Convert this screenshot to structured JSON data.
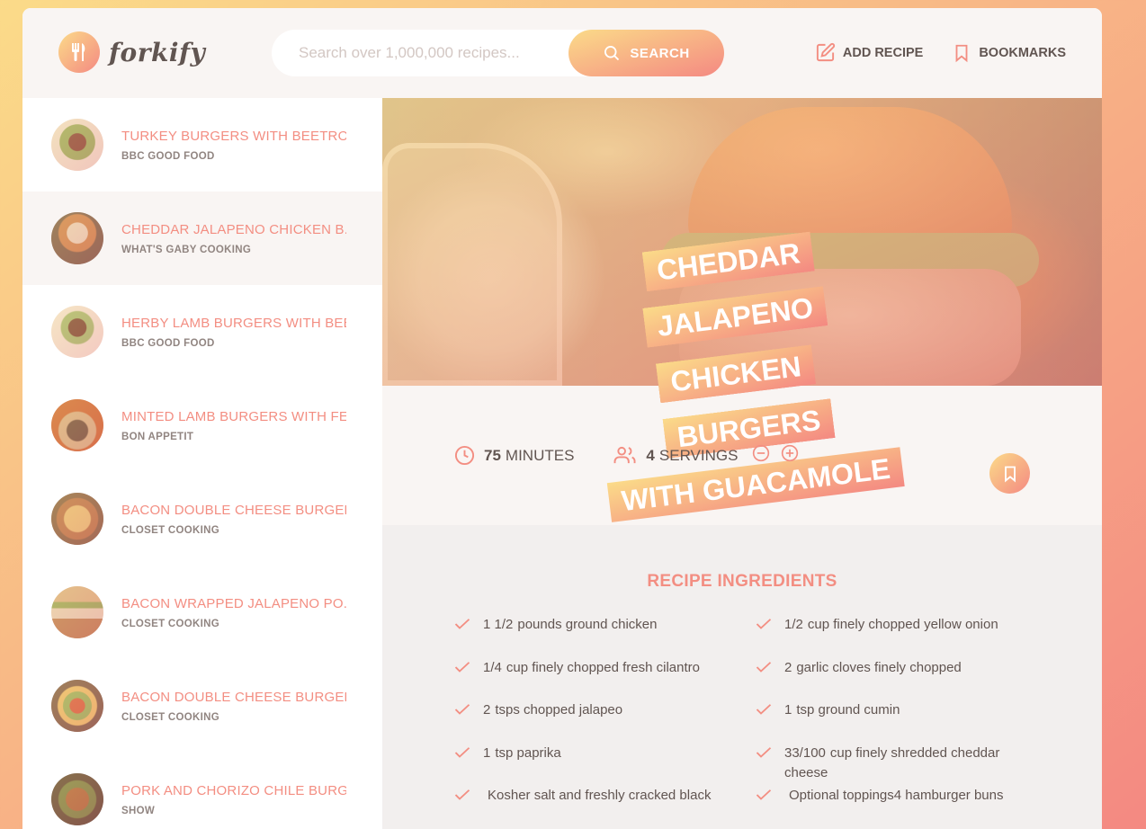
{
  "brand": {
    "name": "forkify"
  },
  "search": {
    "placeholder": "Search over 1,000,000 recipes...",
    "button_label": "SEARCH"
  },
  "nav": {
    "add_recipe": "ADD RECIPE",
    "bookmarks": "BOOKMARKS"
  },
  "results": [
    {
      "title": "TURKEY BURGERS WITH BEETRO...",
      "publisher": "BBC GOOD FOOD"
    },
    {
      "title": "CHEDDAR JALAPENO CHICKEN B...",
      "publisher": "WHAT'S GABY COOKING"
    },
    {
      "title": "HERBY LAMB BURGERS WITH BEE...",
      "publisher": "BBC GOOD FOOD"
    },
    {
      "title": "MINTED LAMB BURGERS WITH FE...",
      "publisher": "BON APPETIT"
    },
    {
      "title": "BACON DOUBLE CHEESE BURGER...",
      "publisher": "CLOSET COOKING"
    },
    {
      "title": "BACON WRAPPED JALAPENO PO...",
      "publisher": "CLOSET COOKING"
    },
    {
      "title": "BACON DOUBLE CHEESE BURGER...",
      "publisher": "CLOSET COOKING"
    },
    {
      "title": "PORK AND CHORIZO CHILE BURG...",
      "publisher": "SHOW"
    }
  ],
  "recipe": {
    "title_lines": [
      "CHEDDAR JALAPENO",
      "CHICKEN BURGERS",
      "WITH GUACAMOLE"
    ],
    "cooking_time": "75",
    "cooking_time_unit": "MINUTES",
    "servings": "4",
    "servings_unit": "SERVINGS",
    "ingredients_heading": "RECIPE INGREDIENTS",
    "ingredients": [
      {
        "quantity": "1 1/2",
        "description": "pounds ground chicken"
      },
      {
        "quantity": "1/2",
        "description": "cup finely chopped yellow onion"
      },
      {
        "quantity": "1/4",
        "description": "cup finely chopped fresh cilantro"
      },
      {
        "quantity": "2",
        "description": "garlic cloves finely chopped"
      },
      {
        "quantity": "2",
        "description": "tsps chopped jalapeo"
      },
      {
        "quantity": "1",
        "description": "tsp ground cumin"
      },
      {
        "quantity": "1",
        "description": "tsp paprika"
      },
      {
        "quantity": "33/100",
        "description": "cup finely shredded cheddar cheese"
      },
      {
        "quantity": "",
        "description": "Kosher salt and freshly cracked black"
      },
      {
        "quantity": "",
        "description": "Optional toppings4 hamburger buns"
      }
    ]
  },
  "colors": {
    "accent": "#f38e82",
    "gradient_start": "#fbdb89",
    "gradient_end": "#f48982"
  }
}
